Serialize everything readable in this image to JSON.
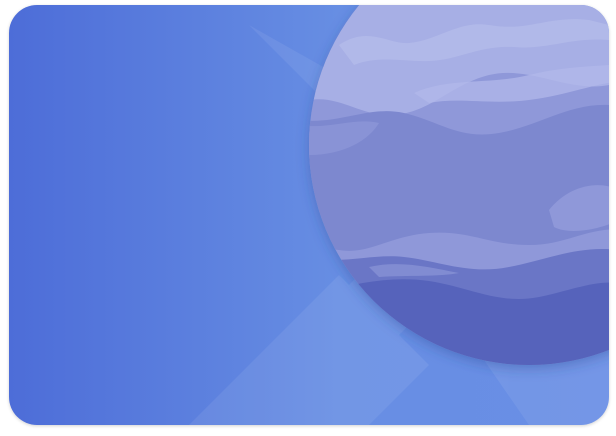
{
  "wallpaper": {
    "name": "planet-wallpaper",
    "colors": {
      "background_left": "#4f72da",
      "background_right": "#6b90e4",
      "planet_light": "#a8b0e6",
      "planet_mid": "#8f98d9",
      "planet_dark": "#6c78c8",
      "planet_darkest": "#5563b8"
    }
  }
}
